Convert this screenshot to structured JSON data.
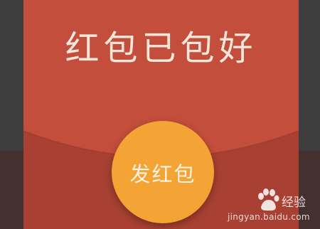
{
  "envelope": {
    "title": "红包已包好",
    "open_button_label": "发红包"
  },
  "watermark": {
    "name": "经验",
    "url": "jingyan.baidu.com"
  },
  "colors": {
    "backdrop": "#3d3d3d",
    "envelope_top": "#c34e3c",
    "envelope_bottom": "#a84133",
    "button": "#f3a435",
    "text": "#f6e7da"
  }
}
